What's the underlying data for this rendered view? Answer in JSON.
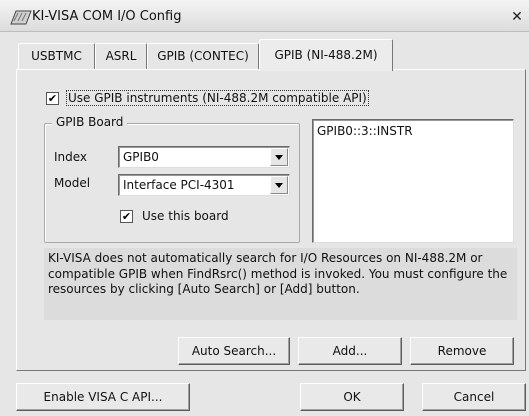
{
  "window": {
    "title": "KI-VISA COM I/O Config",
    "close_glyph": "✕"
  },
  "tabs": [
    {
      "label": "USBTMC"
    },
    {
      "label": "ASRL"
    },
    {
      "label": "GPIB (CONTEC)"
    },
    {
      "label": "GPIB (NI-488.2M)",
      "active": true
    }
  ],
  "gpib": {
    "use_instruments_label": "Use GPIB instruments (NI-488.2M compatible API)",
    "use_instruments_checked": true,
    "board_group_title": "GPIB Board",
    "index_label": "Index",
    "index_value": "GPIB0",
    "model_label": "Model",
    "model_value": "Interface PCI-4301",
    "use_board_label": "Use this board",
    "use_board_checked": true,
    "check_glyph": "✔"
  },
  "resources": [
    "GPIB0::3::INSTR"
  ],
  "info_text": "KI-VISA does not automatically search for I/O Resources on NI-488.2M or compatible GPIB when FindRsrc() method is invoked. You must configure the resources by clicking [Auto Search] or [Add] button.",
  "buttons": {
    "auto_search": "Auto Search...",
    "add": "Add...",
    "remove": "Remove",
    "enable_visa_c": "Enable VISA C API...",
    "ok": "OK",
    "cancel": "Cancel"
  }
}
